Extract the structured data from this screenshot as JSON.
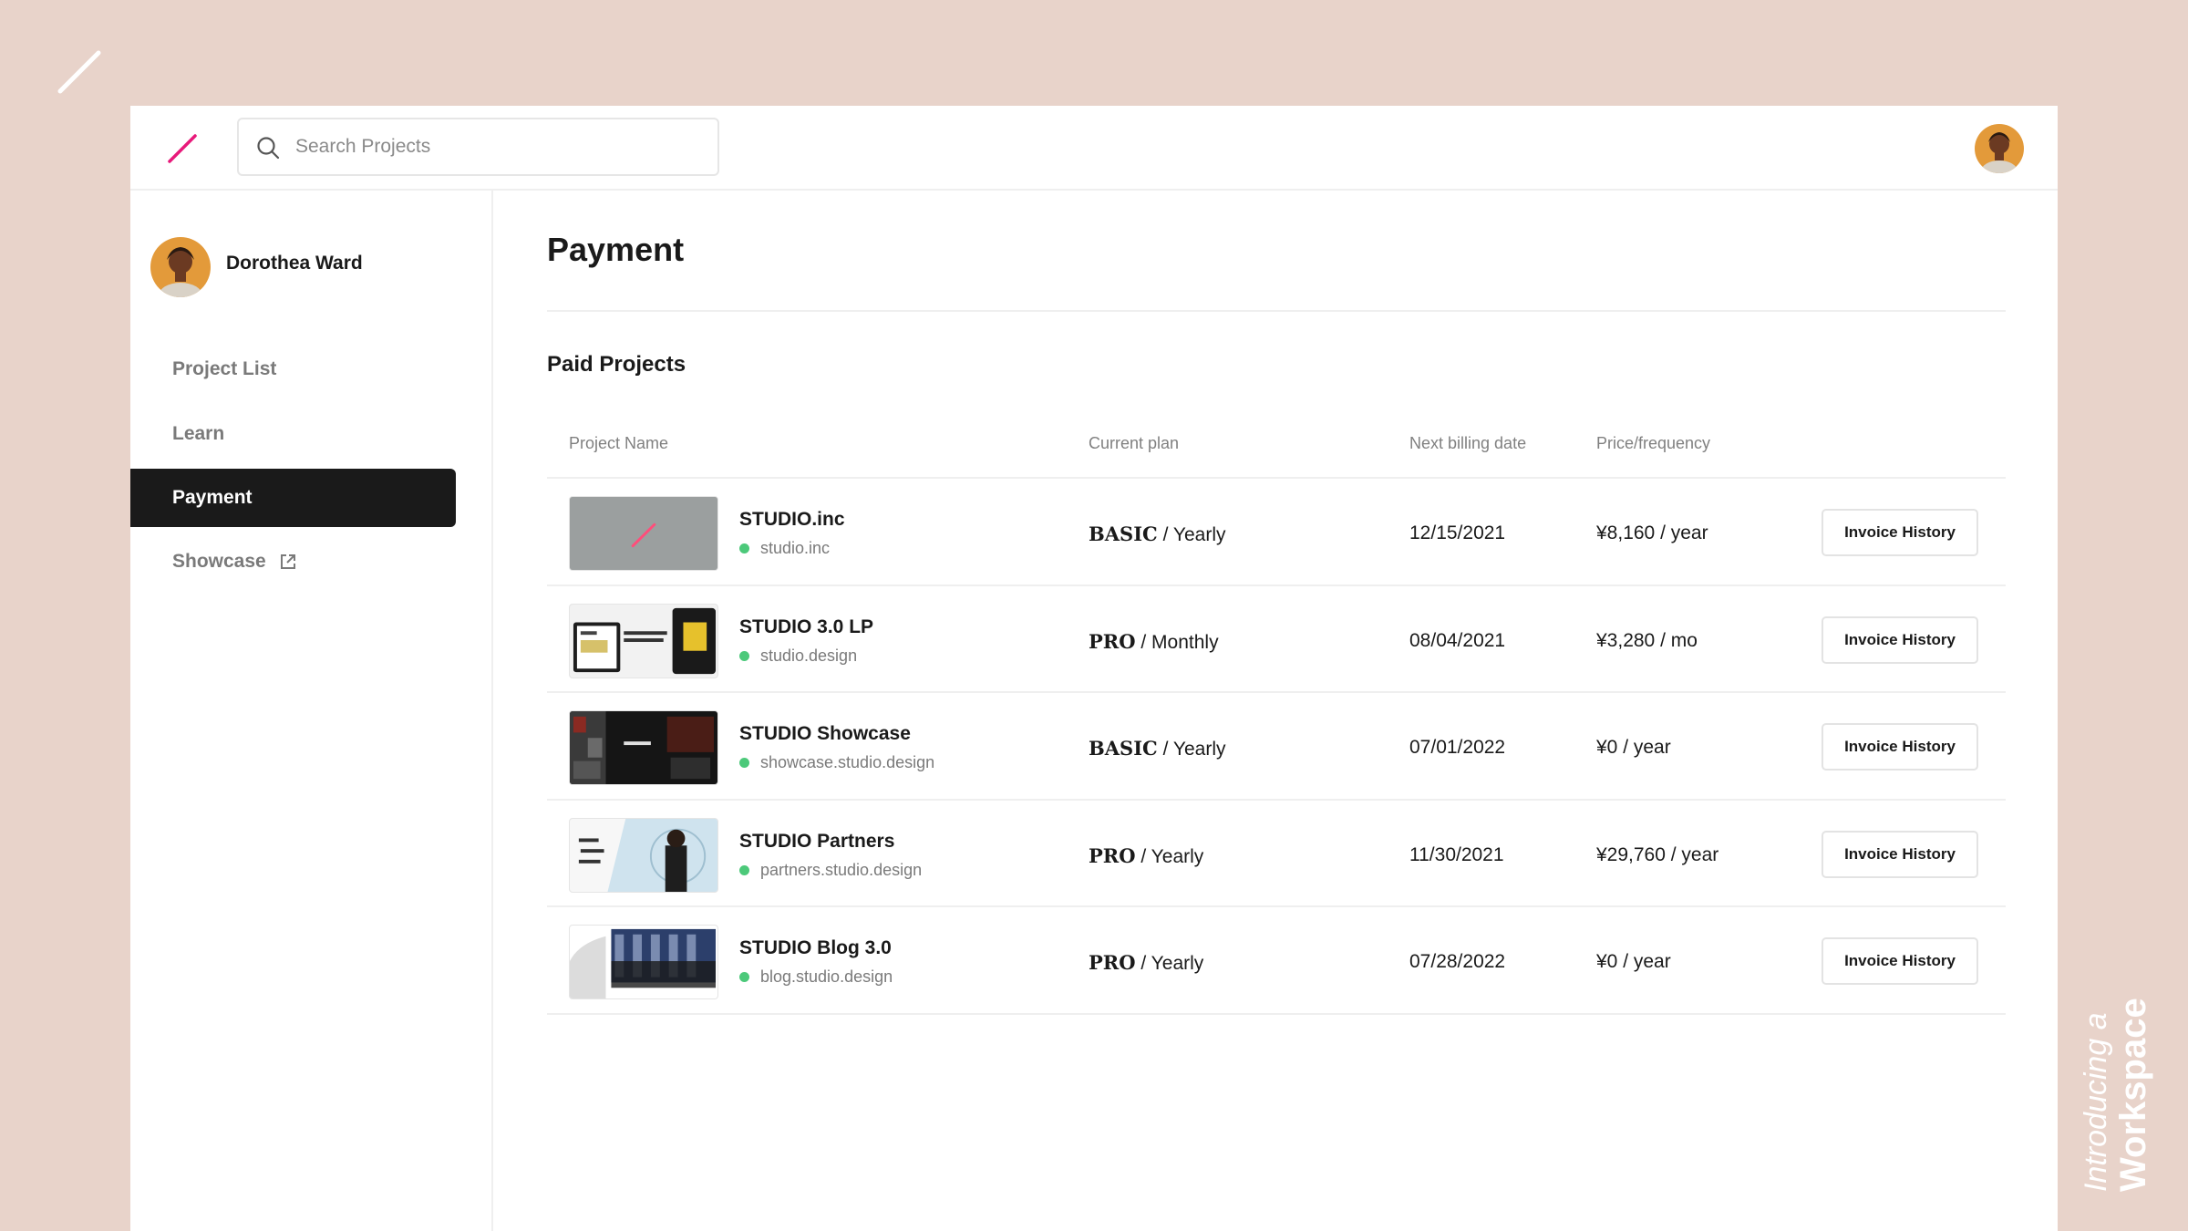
{
  "brand": {
    "accent": "#e8197a",
    "background": "#e8d3ca",
    "status_color": "#4cc97a"
  },
  "search": {
    "placeholder": "Search Projects"
  },
  "user": {
    "name": "Dorothea Ward"
  },
  "sidebar": {
    "items": [
      {
        "label": "Project List",
        "active": false
      },
      {
        "label": "Learn",
        "active": false
      },
      {
        "label": "Payment",
        "active": true
      },
      {
        "label": "Showcase",
        "active": false,
        "icon": "external-link-icon"
      }
    ]
  },
  "main": {
    "title": "Payment",
    "section_title": "Paid Projects",
    "columns": [
      "Project Name",
      "Current plan",
      "Next billing date",
      "Price/frequency"
    ],
    "rows": [
      {
        "name": "STUDIO.inc",
        "domain": "studio.inc",
        "tier": "BASIC",
        "frequency": "/ Yearly",
        "next_billing": "12/15/2021",
        "price": "¥8,160 / year",
        "action": "Invoice History"
      },
      {
        "name": "STUDIO 3.0 LP",
        "domain": "studio.design",
        "tier": "PRO",
        "frequency": "/ Monthly",
        "next_billing": "08/04/2021",
        "price": "¥3,280 / mo",
        "action": "Invoice History"
      },
      {
        "name": "STUDIO Showcase",
        "domain": "showcase.studio.design",
        "tier": "BASIC",
        "frequency": "/ Yearly",
        "next_billing": "07/01/2022",
        "price": "¥0 / year",
        "action": "Invoice History"
      },
      {
        "name": "STUDIO Partners",
        "domain": "partners.studio.design",
        "tier": "PRO",
        "frequency": "/ Yearly",
        "next_billing": "11/30/2021",
        "price": "¥29,760 / year",
        "action": "Invoice History"
      },
      {
        "name": "STUDIO Blog 3.0",
        "domain": "blog.studio.design",
        "tier": "PRO",
        "frequency": "/ Yearly",
        "next_billing": "07/28/2022",
        "price": "¥0 / year",
        "action": "Invoice History"
      }
    ]
  },
  "tagline": {
    "light": "Introducing a",
    "bold": "Workspace"
  }
}
